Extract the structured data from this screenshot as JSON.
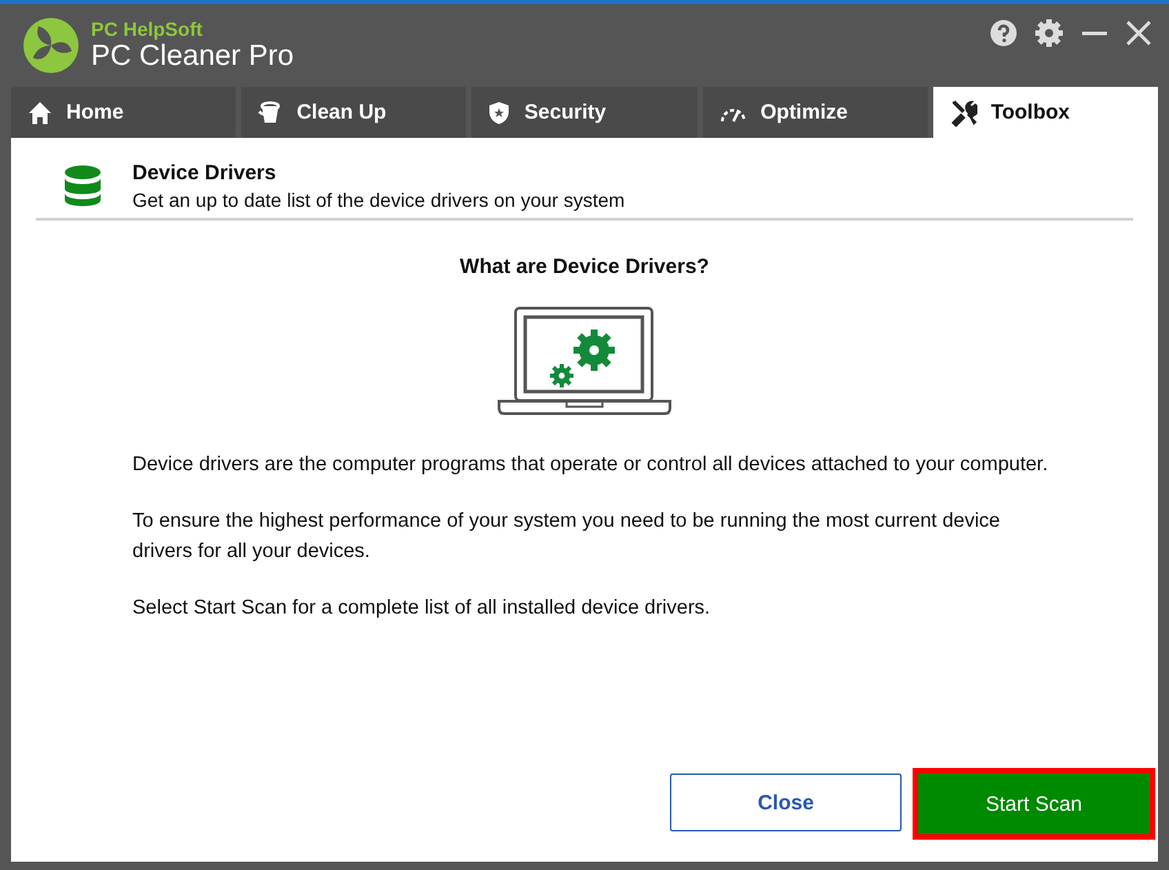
{
  "window": {
    "brand": "PC HelpSoft",
    "title": "PC Cleaner Pro"
  },
  "tabs": [
    {
      "label": "Home",
      "selected": false
    },
    {
      "label": "Clean Up",
      "selected": false
    },
    {
      "label": "Security",
      "selected": false
    },
    {
      "label": "Optimize",
      "selected": false
    },
    {
      "label": "Toolbox",
      "selected": true
    }
  ],
  "section": {
    "title": "Device Drivers",
    "subtitle": "Get an up to date list of the device drivers on your system"
  },
  "heading": "What are Device Drivers?",
  "paragraphs": [
    "Device drivers are the computer programs that operate or control all devices attached to your computer.",
    "To ensure the highest performance of your system you need to be running the most current device drivers for all your devices.",
    "Select Start Scan for a complete list of all installed device drivers."
  ],
  "buttons": [
    {
      "label": "Close",
      "kind": "secondary"
    },
    {
      "label": "Start Scan",
      "kind": "primary"
    }
  ]
}
